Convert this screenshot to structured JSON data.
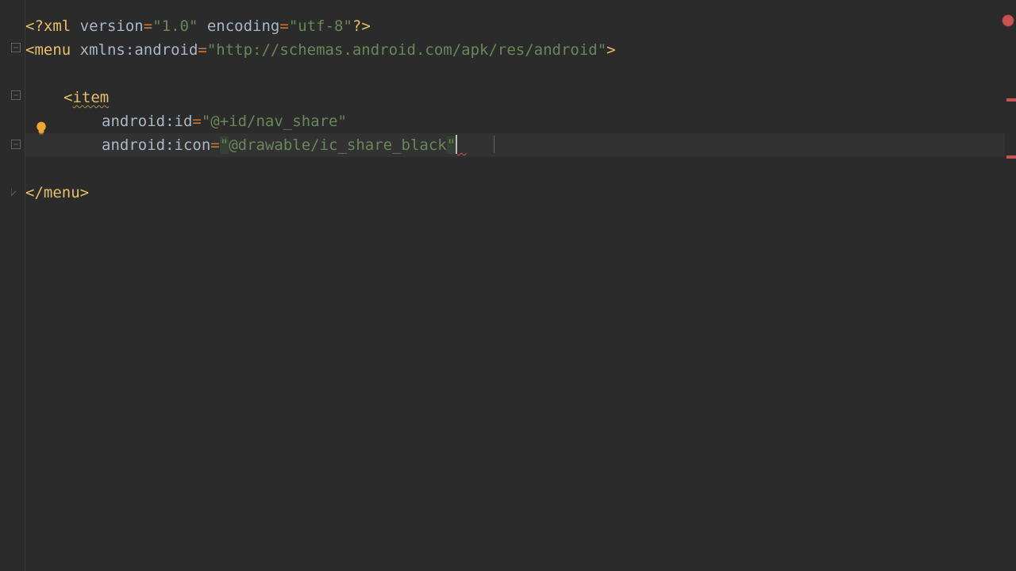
{
  "code": {
    "l1_decl_open": "<?",
    "l1_decl_name": "xml",
    "l1_attr1_name": "version",
    "l1_attr1_val": "\"1.0\"",
    "l1_attr2_name": "encoding",
    "l1_attr2_val": "\"utf-8\"",
    "l1_decl_close": "?>",
    "l2_open": "<",
    "l2_tag": "menu",
    "l2_attr_ns": "xmlns:",
    "l2_attr_name": "android",
    "l2_attr_val": "\"http://schemas.android.com/apk/res/android\"",
    "l2_close": ">",
    "l4_open": "<",
    "l4_tag": "item",
    "l5_attr_ns": "android:",
    "l5_attr_name": "id",
    "l5_attr_val": "\"@+id/nav_share\"",
    "l6_attr_ns": "android:",
    "l6_attr_name": "icon",
    "l6_attr_val_open": "\"",
    "l6_attr_val_body": "@drawable/ic_share_black",
    "l6_attr_val_close": "\"",
    "l8_open": "</",
    "l8_tag": "menu",
    "l8_close": ">"
  },
  "eq": "="
}
